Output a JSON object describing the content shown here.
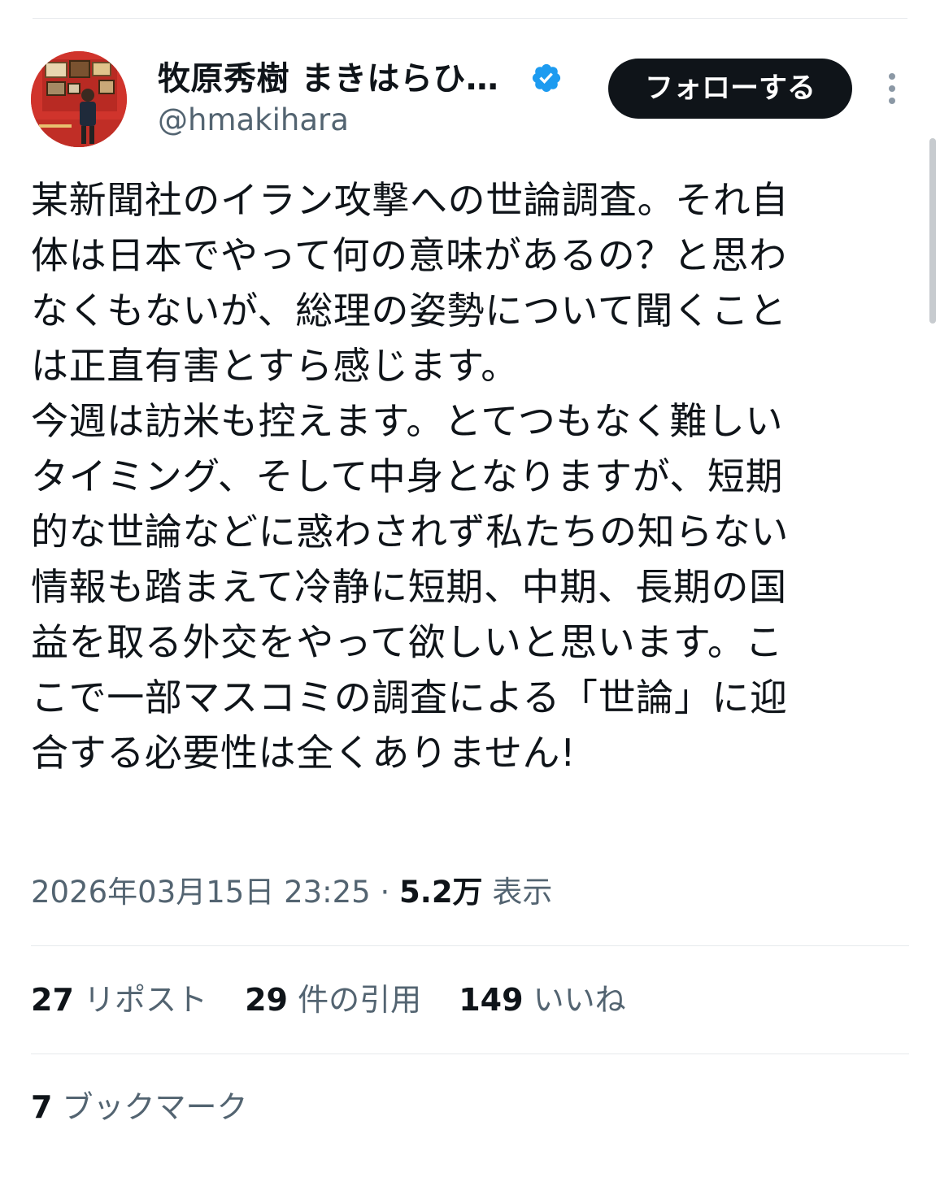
{
  "author": {
    "name": "牧原秀樹 まきはらひ…",
    "handle": "@hmakihara",
    "verified_color": "#1d9bf0"
  },
  "follow_button": {
    "label": "フォローする"
  },
  "tweet": {
    "text": "某新聞社のイラン攻撃への世論調査。それ自\n体は日本でやって何の意味があるの？と思わ\nなくもないが、総理の姿勢について聞くこと\nは正直有害とすら感じます。\n今週は訪米も控えます。とてつもなく難しい\nタイミング、そして中身となりますが、短期\n的な世論などに惑わされず私たちの知らない\n情報も踏まえて冷静に短期、中期、長期の国\n益を取る外交をやって欲しいと思います。こ\nこで一部マスコミの調査による「世論」に迎\n合する必要性は全くありません!",
    "timestamp": "2026年03月15日 23:25",
    "separator": " · ",
    "views_count": "5.2万",
    "views_label": " 表示"
  },
  "stats": {
    "reposts": {
      "count": "27",
      "label": "リポスト"
    },
    "quotes": {
      "count": "29",
      "label": "件の引用"
    },
    "likes": {
      "count": "149",
      "label": "いいね"
    }
  },
  "bookmarks": {
    "count": "7",
    "label": "ブックマーク"
  },
  "colors": {
    "text": "#0f1419",
    "secondary": "#536471",
    "divider": "#e6e9ec",
    "avatar_bg": "#d0342c"
  },
  "icons": {
    "verified": "verified-badge-icon",
    "more": "more-vertical-icon"
  }
}
